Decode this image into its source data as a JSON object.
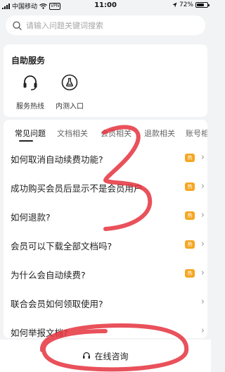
{
  "status_bar": {
    "carrier": "中国移动",
    "vpn": "VPN",
    "time": "11:00",
    "battery_text": "72%",
    "battery_level": 0.72
  },
  "search": {
    "placeholder": "请输入问题关键词搜索"
  },
  "self_service": {
    "title": "自助服务",
    "items": [
      {
        "label": "服务热线",
        "icon": "headset-icon"
      },
      {
        "label": "内测入口",
        "icon": "flask-icon"
      }
    ]
  },
  "faq": {
    "tabs": [
      "常见问题",
      "文档相关",
      "会员相关",
      "退款相关",
      "账号相关"
    ],
    "active_tab": 0,
    "hot_label": "热",
    "items": [
      {
        "question": "如何取消自动续费功能?",
        "hot": true
      },
      {
        "question": "成功购买会员后显示不是会员用户",
        "hot": true
      },
      {
        "question": "如何退款?",
        "hot": true
      },
      {
        "question": "会员可以下载全部文档吗?",
        "hot": true
      },
      {
        "question": "为什么会自动续费?",
        "hot": true
      },
      {
        "question": "联合会员如何领取使用?",
        "hot": false
      },
      {
        "question": "如何举报文档?",
        "hot": false
      }
    ]
  },
  "bottom": {
    "online_consult": "在线咨询"
  },
  "colors": {
    "hot_badge": "#f5a623",
    "annotation": "#e5323e",
    "background": "#f2f3f5"
  }
}
